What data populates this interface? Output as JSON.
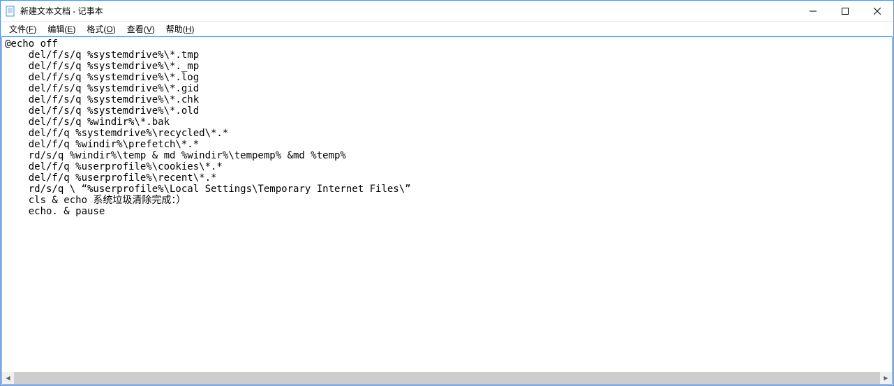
{
  "window": {
    "title": "新建文本文档 - 记事本"
  },
  "menu": {
    "file": {
      "label": "文件",
      "mnemonic": "F"
    },
    "edit": {
      "label": "编辑",
      "mnemonic": "E"
    },
    "format": {
      "label": "格式",
      "mnemonic": "O"
    },
    "view": {
      "label": "查看",
      "mnemonic": "V"
    },
    "help": {
      "label": "帮助",
      "mnemonic": "H"
    }
  },
  "content": {
    "text": "@echo off\n    del/f/s/q %systemdrive%\\*.tmp\n    del/f/s/q %systemdrive%\\*._mp\n    del/f/s/q %systemdrive%\\*.log\n    del/f/s/q %systemdrive%\\*.gid\n    del/f/s/q %systemdrive%\\*.chk\n    del/f/s/q %systemdrive%\\*.old\n    del/f/s/q %windir%\\*.bak\n    del/f/q %systemdrive%\\recycled\\*.*\n    del/f/q %windir%\\prefetch\\*.*\n    rd/s/q %windir%\\temp & md %windir%\\tempemp% &md %temp%\n    del/f/q %userprofile%\\cookies\\*.*\n    del/f/q %userprofile%\\recent\\*.*\n    rd/s/q \\ “%userprofile%\\Local Settings\\Temporary Internet Files\\”\n    cls & echo 系统垃圾清除完成：）\n    echo. & pause"
  },
  "scroll": {
    "left_arrow": "◀",
    "right_arrow": "▶"
  }
}
